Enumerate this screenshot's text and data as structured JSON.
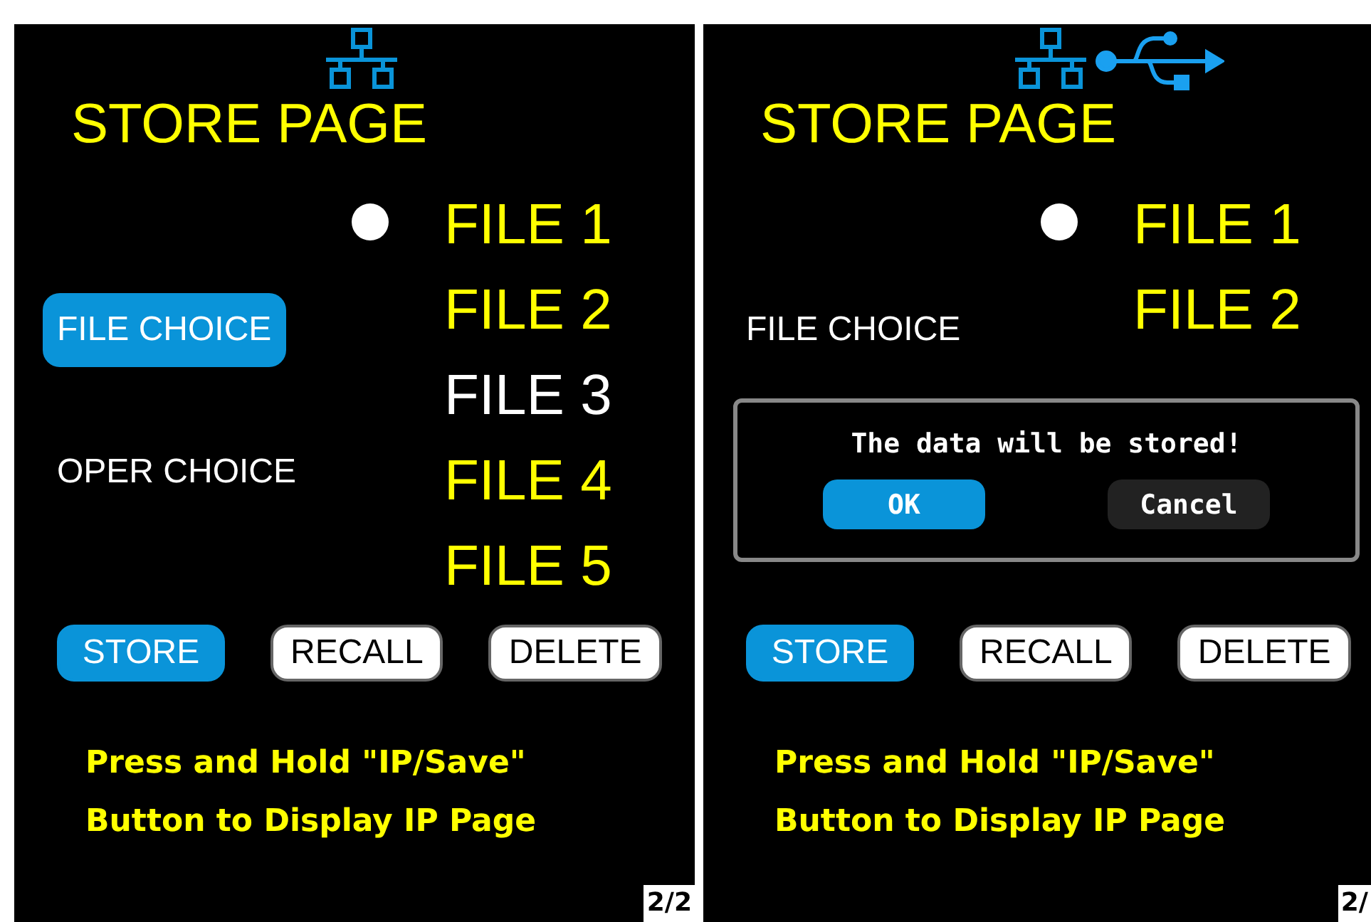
{
  "panels": [
    {
      "status_icons": [
        {
          "kind": "network"
        }
      ],
      "title": "STORE PAGE",
      "choices": [
        {
          "label": "FILE CHOICE",
          "selected": true
        },
        {
          "label": "OPER CHOICE",
          "selected": false
        }
      ],
      "files": [
        {
          "label": "FILE 1",
          "marked": true,
          "selected": false
        },
        {
          "label": "FILE 2",
          "marked": false,
          "selected": false
        },
        {
          "label": "FILE 3",
          "marked": false,
          "selected": true
        },
        {
          "label": "FILE 4",
          "marked": false,
          "selected": false
        },
        {
          "label": "FILE 5",
          "marked": false,
          "selected": false
        }
      ],
      "buttons": [
        {
          "label": "STORE",
          "selected": true
        },
        {
          "label": "RECALL",
          "selected": false
        },
        {
          "label": "DELETE",
          "selected": false
        }
      ],
      "help": [
        "Press and Hold \"IP/Save\"",
        "Button to Display IP Page"
      ],
      "page": "2/2"
    },
    {
      "status_icons": [
        {
          "kind": "network"
        },
        {
          "kind": "usb"
        }
      ],
      "title": "STORE PAGE",
      "choices": [
        {
          "label": "FILE CHOICE",
          "selected": false
        }
      ],
      "files": [
        {
          "label": "FILE 1",
          "marked": true,
          "selected": false
        },
        {
          "label": "FILE 2",
          "marked": false,
          "selected": false
        }
      ],
      "buttons": [
        {
          "label": "STORE",
          "selected": true
        },
        {
          "label": "RECALL",
          "selected": false
        },
        {
          "label": "DELETE",
          "selected": false
        }
      ],
      "help": [
        "Press and Hold \"IP/Save\"",
        "Button to Display IP Page"
      ],
      "page": "2/",
      "dialog": {
        "message": "The data will be stored!",
        "buttons": [
          {
            "label": "OK",
            "selected": true
          },
          {
            "label": "Cancel",
            "selected": false
          }
        ]
      }
    }
  ]
}
